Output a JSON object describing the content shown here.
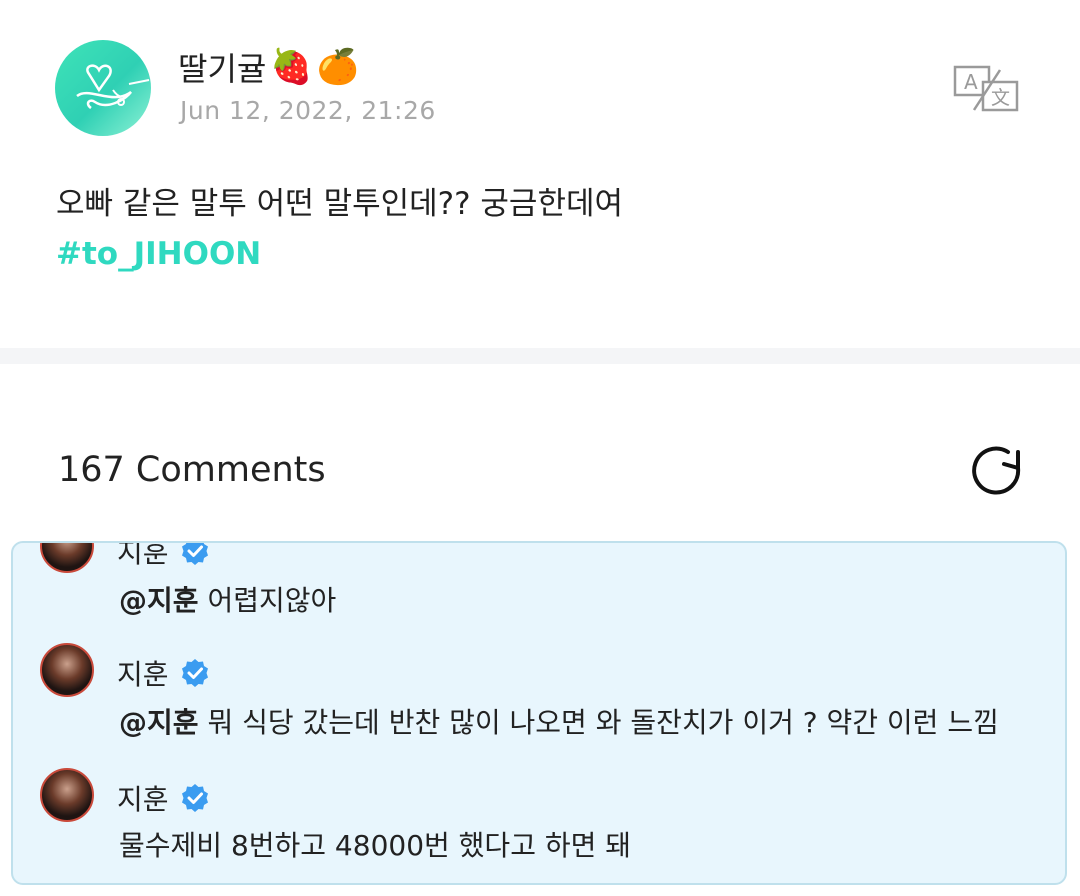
{
  "post": {
    "author": "딸기귤",
    "author_emoji_1": "🍓",
    "author_emoji_2": "🍊",
    "date": "Jun 12, 2022, 21:26",
    "text": "오빠 같은 말투 어떤 말투인데?? 궁금한데여",
    "hashtag": "#to_JIHOON",
    "translate_icon": "translate-icon"
  },
  "comments_section": {
    "count_label": "167 Comments",
    "refresh_icon": "refresh-icon"
  },
  "comments": [
    {
      "author": "지훈",
      "mention": "@지훈",
      "text": "어렵지않아"
    },
    {
      "author": "지훈",
      "mention": "@지훈",
      "text": "뭐 식당 갔는데 반찬 많이 나오면 와 돌잔치가 이거 ? 약간 이런 느낌"
    },
    {
      "author": "지훈",
      "text": "물수제비 8번하고 48000번 했다고 하면 돼"
    }
  ],
  "colors": {
    "accent": "#2fd9c0",
    "comment_bg": "#e8f6fd",
    "verified": "#3b9cf0"
  }
}
